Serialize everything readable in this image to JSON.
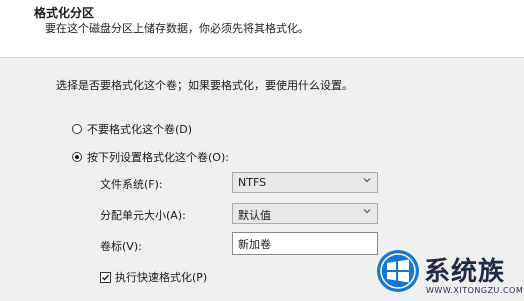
{
  "header": {
    "title": "格式化分区",
    "subtitle": "要在这个磁盘分区上储存数据，你必须先将其格式化。"
  },
  "panel": {
    "description": "选择是否要格式化这个卷；如果要格式化，要使用什么设置。",
    "options": [
      {
        "label": "不要格式化这个卷(D)",
        "selected": false
      },
      {
        "label": "按下列设置格式化这个卷(O):",
        "selected": true
      }
    ],
    "fields": {
      "filesystem": {
        "label": "文件系统(F):",
        "value": "NTFS"
      },
      "allocation": {
        "label": "分配单元大小(A):",
        "value": "默认值"
      },
      "volume_label": {
        "label": "卷标(V):",
        "value": "新加卷"
      }
    },
    "quick_format": {
      "label": "执行快速格式化(P)",
      "checked": true
    }
  },
  "watermark": {
    "text": "系统族",
    "url": "WWW.XITONGZU.COM"
  },
  "colors": {
    "panel_bg": "#f0f0f0",
    "logo_blue": "#1677d2"
  }
}
